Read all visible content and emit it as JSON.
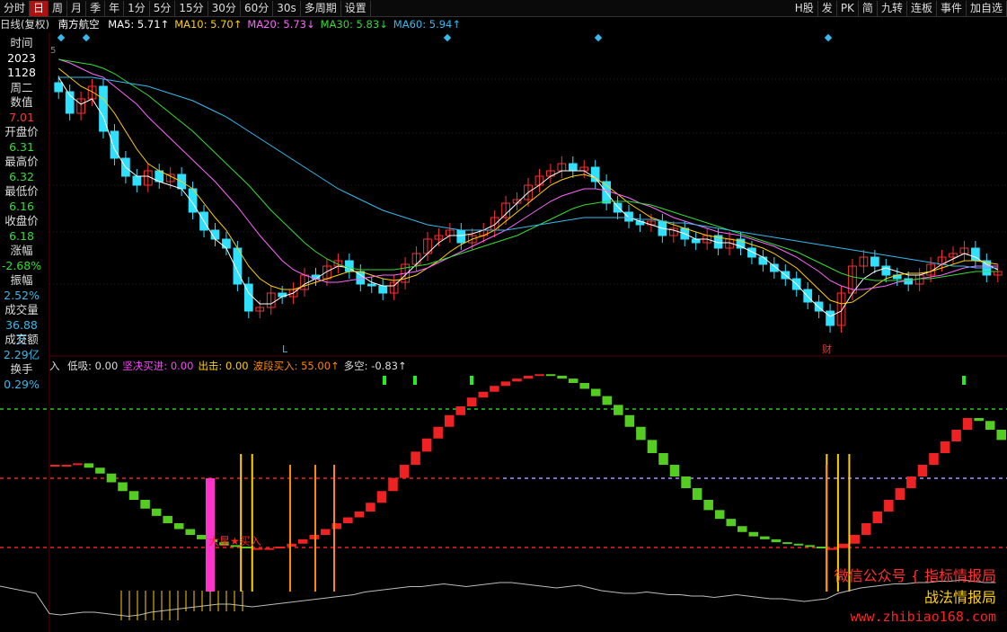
{
  "toolbar": {
    "items": [
      "分时",
      "日",
      "周",
      "月",
      "季",
      "年",
      "1分",
      "5分",
      "15分",
      "30分",
      "60分",
      "30s",
      "多周期",
      "设置"
    ],
    "active": 1,
    "right": [
      "H股",
      "发",
      "PK",
      "简",
      "九转",
      "连板",
      "事件",
      "加自选"
    ]
  },
  "header": {
    "kline_label": "日线(复权)",
    "stock_name": "南方航空",
    "ma": [
      {
        "label": "MA5: 5.71",
        "arrow": "↑",
        "color": "#ffffff"
      },
      {
        "label": "MA10: 5.70",
        "arrow": "↑",
        "color": "#ffd000"
      },
      {
        "label": "MA20: 5.73",
        "arrow": "↓",
        "color": "#ff66ff"
      },
      {
        "label": "MA30: 5.83",
        "arrow": "↓",
        "color": "#33dd33"
      },
      {
        "label": "MA60: 5.94",
        "arrow": "↑",
        "color": "#33bbee"
      }
    ]
  },
  "info_panel": [
    {
      "label": "时间",
      "value": "2023",
      "color": "#ffffff"
    },
    {
      "label": "",
      "value": "1128",
      "color": "#ffffff"
    },
    {
      "label": "周二",
      "value": "",
      "color": "#ffffff"
    },
    {
      "label": "数值",
      "value": "7.01",
      "color": "#ff3333"
    },
    {
      "label": "开盘价",
      "value": "6.31",
      "color": "#33dd33"
    },
    {
      "label": "最高价",
      "value": "6.32",
      "color": "#33dd33"
    },
    {
      "label": "最低价",
      "value": "6.16",
      "color": "#33dd33"
    },
    {
      "label": "收盘价",
      "value": "6.18",
      "color": "#33dd33"
    },
    {
      "label": "涨幅",
      "value": "-2.68%",
      "color": "#33dd33"
    },
    {
      "label": "振幅",
      "value": "2.52%",
      "color": "#33bbee"
    },
    {
      "label": "成交量",
      "value": "36.88万",
      "color": "#33bbee"
    },
    {
      "label": "成交额",
      "value": "2.29亿",
      "color": "#33bbee"
    },
    {
      "label": "换手",
      "value": "0.29%",
      "color": "#33bbee"
    }
  ],
  "chart_markers": {
    "low_label": "L",
    "fin_label": "财",
    "buy_label": "大星★买入",
    "corner_label": "5"
  },
  "indicator": {
    "prefix": "入",
    "items": [
      {
        "label": "低吸: 0.00",
        "color": "#dddddd"
      },
      {
        "label": "坚决买进: 0.00",
        "color": "#ff44ff"
      },
      {
        "label": "出击: 0.00",
        "color": "#ffd000"
      },
      {
        "label": "波段买入: 55.00↑",
        "color": "#ff8800"
      },
      {
        "label": "多空: -0.83↑",
        "color": "#dddddd"
      }
    ]
  },
  "watermark": {
    "line1": "微信公众号",
    "line2a": "指标情报局",
    "line2b": "战法情报局",
    "url": "www.zhibiao168.com"
  },
  "colors": {
    "up": "#ff3030",
    "down": "#30e0ff",
    "grid": "#7a0000",
    "ma5": "#ffffff",
    "ma10": "#ffd000",
    "ma20": "#ff66ff",
    "ma30": "#33dd33",
    "ma60": "#33bbee"
  },
  "chart_data": [
    {
      "type": "candlestick",
      "title": "南方航空 日线(复权)",
      "close": [
        6.92,
        6.8,
        6.88,
        6.95,
        6.7,
        6.55,
        6.45,
        6.4,
        6.48,
        6.42,
        6.46,
        6.38,
        6.25,
        6.15,
        6.1,
        6.05,
        5.85,
        5.7,
        5.72,
        5.8,
        5.78,
        5.82,
        5.9,
        5.88,
        5.95,
        5.98,
        5.92,
        5.85,
        5.84,
        5.8,
        5.86,
        5.96,
        6.02,
        6.1,
        6.12,
        6.15,
        6.08,
        6.12,
        6.15,
        6.22,
        6.3,
        6.32,
        6.4,
        6.45,
        6.48,
        6.52,
        6.48,
        6.5,
        6.42,
        6.3,
        6.25,
        6.2,
        6.18,
        6.2,
        6.12,
        6.16,
        6.1,
        6.08,
        6.12,
        6.05,
        6.1,
        6.05,
        6.0,
        5.96,
        5.92,
        5.88,
        5.82,
        5.75,
        5.7,
        5.62,
        5.8,
        5.95,
        6.0,
        5.95,
        5.9,
        5.88,
        5.85,
        5.9,
        5.96,
        6.0,
        6.02,
        6.05,
        5.98,
        5.9,
        5.92
      ],
      "ma": {
        "MA5": [
          7.0,
          6.9,
          6.85,
          6.88,
          6.78,
          6.6,
          6.5,
          6.45,
          6.45,
          6.42,
          6.4,
          6.38,
          6.3,
          6.2,
          6.1,
          6.05,
          5.92,
          5.8,
          5.74,
          5.74,
          5.78,
          5.8,
          5.85,
          5.88,
          5.92,
          5.95,
          5.94,
          5.9,
          5.86,
          5.84,
          5.84,
          5.9,
          5.96,
          6.02,
          6.08,
          6.12,
          6.12,
          6.13,
          6.15,
          6.18,
          6.24,
          6.3,
          6.36,
          6.4,
          6.45,
          6.48,
          6.48,
          6.48,
          6.44,
          6.36,
          6.28,
          6.22,
          6.2,
          6.18,
          6.16,
          6.15,
          6.13,
          6.1,
          6.1,
          6.08,
          6.08,
          6.06,
          6.03,
          6.0,
          5.95,
          5.9,
          5.85,
          5.78,
          5.72,
          5.67,
          5.7,
          5.8,
          5.88,
          5.92,
          5.94,
          5.92,
          5.9,
          5.9,
          5.92,
          5.96,
          5.99,
          6.02,
          6.0,
          5.96,
          5.93
        ],
        "MA10": [
          7.05,
          7.0,
          6.95,
          6.92,
          6.88,
          6.8,
          6.7,
          6.6,
          6.52,
          6.48,
          6.45,
          6.42,
          6.38,
          6.3,
          6.22,
          6.15,
          6.05,
          5.95,
          5.88,
          5.84,
          5.82,
          5.82,
          5.84,
          5.86,
          5.88,
          5.9,
          5.92,
          5.92,
          5.9,
          5.88,
          5.87,
          5.88,
          5.9,
          5.94,
          5.98,
          6.03,
          6.07,
          6.1,
          6.12,
          6.15,
          6.2,
          6.25,
          6.3,
          6.35,
          6.4,
          6.43,
          6.45,
          6.46,
          6.44,
          6.4,
          6.35,
          6.3,
          6.26,
          6.22,
          6.2,
          6.18,
          6.16,
          6.14,
          6.12,
          6.11,
          6.1,
          6.09,
          6.07,
          6.05,
          6.02,
          5.98,
          5.94,
          5.88,
          5.82,
          5.76,
          5.74,
          5.75,
          5.79,
          5.84,
          5.88,
          5.9,
          5.91,
          5.91,
          5.92,
          5.94,
          5.96,
          5.98,
          5.98,
          5.97,
          5.96
        ],
        "MA20": [
          7.1,
          7.08,
          7.05,
          7.02,
          7.0,
          6.95,
          6.9,
          6.85,
          6.78,
          6.72,
          6.66,
          6.6,
          6.54,
          6.48,
          6.42,
          6.35,
          6.28,
          6.2,
          6.12,
          6.05,
          5.98,
          5.93,
          5.9,
          5.88,
          5.86,
          5.86,
          5.87,
          5.88,
          5.89,
          5.9,
          5.9,
          5.91,
          5.92,
          5.94,
          5.97,
          6.0,
          6.03,
          6.06,
          6.09,
          6.12,
          6.15,
          6.19,
          6.23,
          6.27,
          6.31,
          6.34,
          6.36,
          6.38,
          6.38,
          6.37,
          6.35,
          6.33,
          6.3,
          6.28,
          6.25,
          6.22,
          6.2,
          6.18,
          6.16,
          6.14,
          6.13,
          6.12,
          6.1,
          6.08,
          6.06,
          6.03,
          6.0,
          5.96,
          5.92,
          5.87,
          5.84,
          5.82,
          5.82,
          5.83,
          5.84,
          5.86,
          5.87,
          5.88,
          5.89,
          5.9,
          5.92,
          5.94,
          5.95,
          5.95,
          5.95
        ],
        "MA30": [
          7.1,
          7.09,
          7.08,
          7.07,
          7.05,
          7.02,
          6.98,
          6.94,
          6.9,
          6.85,
          6.8,
          6.75,
          6.7,
          6.64,
          6.58,
          6.52,
          6.46,
          6.4,
          6.33,
          6.26,
          6.2,
          6.14,
          6.08,
          6.03,
          5.99,
          5.96,
          5.94,
          5.93,
          5.93,
          5.93,
          5.93,
          5.94,
          5.95,
          5.96,
          5.98,
          6.0,
          6.02,
          6.04,
          6.06,
          6.08,
          6.1,
          6.12,
          6.15,
          6.18,
          6.21,
          6.24,
          6.27,
          6.29,
          6.3,
          6.31,
          6.31,
          6.31,
          6.3,
          6.29,
          6.27,
          6.25,
          6.23,
          6.21,
          6.19,
          6.17,
          6.15,
          6.13,
          6.11,
          6.09,
          6.07,
          6.05,
          6.03,
          6.0,
          5.97,
          5.94,
          5.91,
          5.89,
          5.88,
          5.87,
          5.87,
          5.87,
          5.87,
          5.88,
          5.88,
          5.89,
          5.9,
          5.91,
          5.92,
          5.92,
          5.92
        ],
        "MA60": [
          7.0,
          7.0,
          7.0,
          7.0,
          6.99,
          6.98,
          6.97,
          6.96,
          6.95,
          6.93,
          6.91,
          6.89,
          6.87,
          6.84,
          6.81,
          6.78,
          6.74,
          6.7,
          6.66,
          6.62,
          6.58,
          6.54,
          6.5,
          6.46,
          6.42,
          6.38,
          6.35,
          6.32,
          6.29,
          6.26,
          6.24,
          6.22,
          6.2,
          6.18,
          6.17,
          6.16,
          6.15,
          6.15,
          6.15,
          6.15,
          6.15,
          6.16,
          6.17,
          6.18,
          6.19,
          6.2,
          6.21,
          6.22,
          6.22,
          6.22,
          6.22,
          6.22,
          6.21,
          6.21,
          6.2,
          6.19,
          6.19,
          6.18,
          6.17,
          6.16,
          6.15,
          6.14,
          6.13,
          6.12,
          6.11,
          6.1,
          6.09,
          6.08,
          6.07,
          6.06,
          6.05,
          6.04,
          6.03,
          6.02,
          6.01,
          6.0,
          5.99,
          5.98,
          5.97,
          5.96,
          5.95,
          5.95,
          5.94,
          5.94,
          5.94
        ]
      },
      "ylim": [
        5.55,
        7.25
      ]
    },
    {
      "type": "line",
      "title": "波段指标",
      "values": [
        88,
        88,
        89,
        86,
        82,
        76,
        70,
        64,
        58,
        53,
        48,
        44,
        40,
        37,
        35,
        33,
        32,
        31,
        31,
        31,
        32,
        34,
        37,
        40,
        44,
        48,
        52,
        56,
        62,
        70,
        79,
        88,
        97,
        106,
        114,
        122,
        128,
        134,
        138,
        142,
        145,
        147,
        149,
        150,
        149,
        147,
        144,
        140,
        135,
        129,
        122,
        114,
        105,
        96,
        88,
        80,
        72,
        64,
        57,
        51,
        46,
        42,
        39,
        37,
        35,
        34,
        33,
        32,
        31,
        31,
        34,
        40,
        48,
        56,
        64,
        72,
        80,
        88,
        96,
        104,
        112,
        120,
        118,
        112,
        105
      ],
      "ylim": [
        0,
        160
      ],
      "buy_signal_indices": [
        17,
        18,
        69,
        70,
        71
      ],
      "bottom_line": [
        5,
        4,
        5,
        6,
        6,
        5,
        4,
        3,
        4,
        6,
        7,
        8,
        9,
        10,
        11,
        12,
        12,
        11,
        10,
        11,
        12,
        13,
        14,
        15,
        16,
        17,
        18,
        19,
        21,
        22,
        23,
        24,
        25,
        25,
        26,
        27,
        26,
        25,
        26,
        27,
        28,
        28,
        27,
        26,
        25,
        24,
        25,
        26,
        24,
        22,
        21,
        20,
        20,
        21,
        20,
        19,
        19,
        18,
        18,
        17,
        18,
        19,
        18,
        17,
        16,
        16,
        15,
        14,
        15,
        16,
        20,
        22,
        24,
        25,
        26,
        27,
        27,
        28,
        28,
        29,
        29,
        30,
        29,
        28,
        28
      ]
    }
  ]
}
